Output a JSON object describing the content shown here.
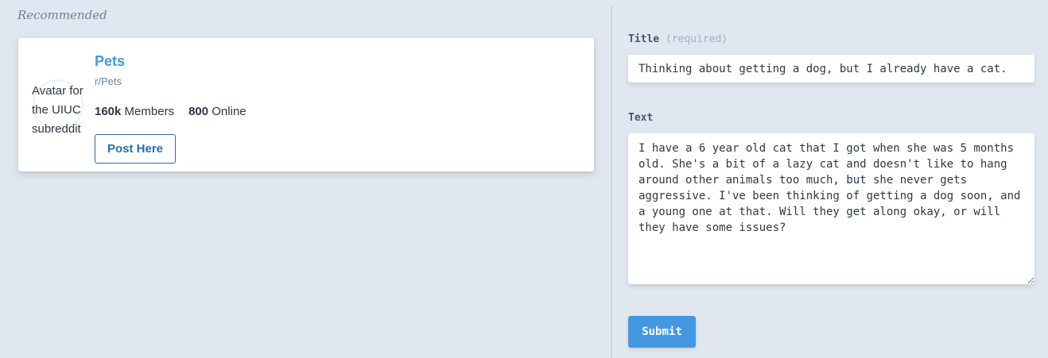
{
  "recommended": {
    "heading": "Recommended",
    "card": {
      "avatar_alt": "Avatar for the UIUC subreddit",
      "name": "Pets",
      "path": "r/Pets",
      "members_count": "160k",
      "members_label": "Members",
      "online_count": "800",
      "online_label": "Online",
      "post_button": "Post Here"
    }
  },
  "form": {
    "title_label": "Title",
    "title_required": "(required)",
    "title_value": "Thinking about getting a dog, but I already have a cat.",
    "text_label": "Text",
    "text_value": "I have a 6 year old cat that I got when she was 5 months old. She's a bit of a lazy cat and doesn't like to hang around other animals too much, but she never gets aggressive. I've been thinking of getting a dog soon, and a young one at that. Will they get along okay, or will they have some issues?",
    "submit_label": "Submit"
  },
  "colors": {
    "background": "#e1e7f0",
    "accent": "#4299e1",
    "button_outline": "#2b6cb0"
  }
}
